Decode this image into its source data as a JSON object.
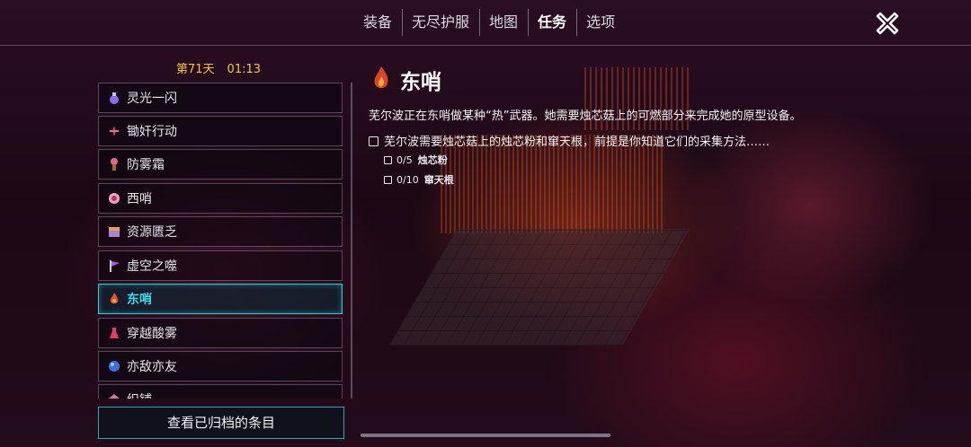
{
  "nav": {
    "tabs": [
      {
        "label": "装备",
        "active": false
      },
      {
        "label": "无尽护服",
        "active": false
      },
      {
        "label": "地图",
        "active": false
      },
      {
        "label": "任务",
        "active": true
      },
      {
        "label": "选项",
        "active": false
      }
    ],
    "close_icon": "close-x-icon"
  },
  "status": {
    "day": "第71天",
    "time": "01:13"
  },
  "quests": [
    {
      "label": "灵光一闪",
      "icon": "potion-icon",
      "color": "#8a6cf0"
    },
    {
      "label": "锄奸行动",
      "icon": "dagger-icon",
      "color": "#c0436a"
    },
    {
      "label": "防雾霜",
      "icon": "torch-icon",
      "color": "#e06a8a"
    },
    {
      "label": "西哨",
      "icon": "crystal-icon",
      "color": "#f0a0c0"
    },
    {
      "label": "资源匮乏",
      "icon": "chest-icon",
      "color": "#b080d0"
    },
    {
      "label": "虚空之噬",
      "icon": "flag-icon",
      "color": "#a060e0"
    },
    {
      "label": "东哨",
      "icon": "flame-icon",
      "color": "#e05030",
      "active": true
    },
    {
      "label": "穿越酸雾",
      "icon": "flask-icon",
      "color": "#e04060"
    },
    {
      "label": "亦敌亦友",
      "icon": "orb-icon",
      "color": "#4070e0"
    },
    {
      "label": "织铺",
      "icon": "gem-icon",
      "color": "#e070a0"
    }
  ],
  "archive_button": "查看已归档的条目",
  "detail": {
    "title": "东哨",
    "icon": "flame-icon",
    "description": "芜尔波正在东哨做某种“热”武器。她需要烛芯菇上的可燃部分来完成她的原型设备。",
    "objective": "芜尔波需要烛芯菇上的烛芯粉和窜天根，前提是你知道它们的采集方法……",
    "sub_objectives": [
      {
        "progress": "0/5",
        "name": "烛芯粉"
      },
      {
        "progress": "0/10",
        "name": "窜天根"
      }
    ]
  },
  "colors": {
    "accent": "#36c9d8",
    "gold": "#f5c542"
  }
}
